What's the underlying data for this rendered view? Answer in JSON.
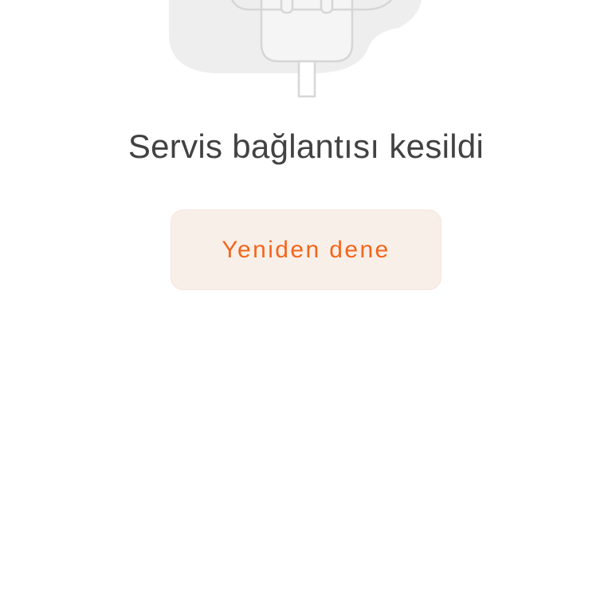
{
  "empty_state": {
    "illustration_icon": "unplugged-plug-icon",
    "title": "Servis bağlantısı kesildi"
  },
  "retry_button": {
    "label": "Yeniden dene"
  },
  "colors": {
    "accent": "#f2661c",
    "button_background": "#f9efe9",
    "title_text": "#424242",
    "illustration_fill": "#eeeeee",
    "illustration_stroke": "#d6d6d6"
  }
}
